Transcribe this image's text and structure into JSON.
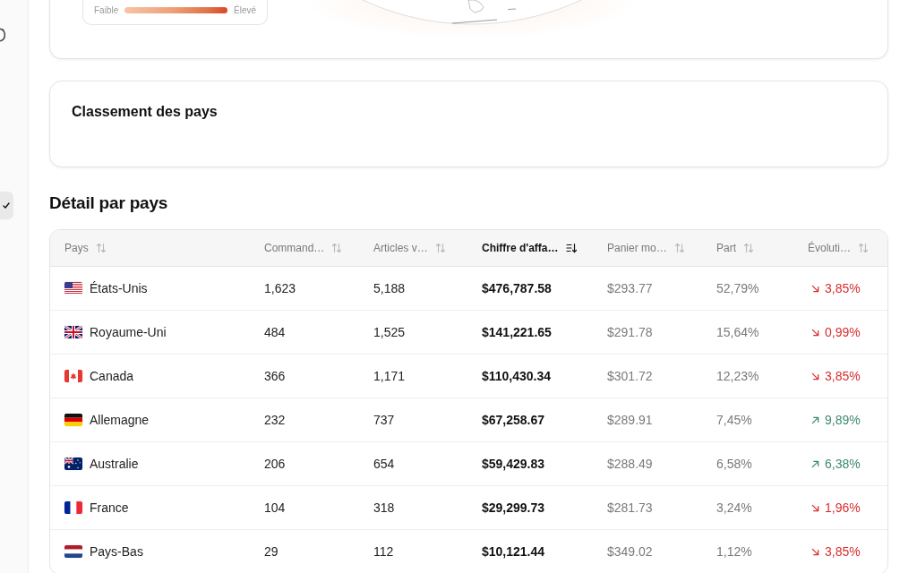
{
  "sidebar": {
    "items": [
      {
        "selected": false
      },
      {
        "selected": true
      }
    ]
  },
  "map_card": {
    "legend": {
      "low_label": "Faible",
      "high_label": "Élevé"
    }
  },
  "ranking_card": {
    "title": "Classement des pays"
  },
  "detail": {
    "title": "Détail par pays",
    "table": {
      "columns": [
        {
          "label": "Pays",
          "selected": false
        },
        {
          "label": "Command…",
          "selected": false
        },
        {
          "label": "Articles v…",
          "selected": false
        },
        {
          "label": "Chiffre d'affa…",
          "selected": true
        },
        {
          "label": "Panier mo…",
          "selected": false
        },
        {
          "label": "Part",
          "selected": false
        },
        {
          "label": "Évoluti…",
          "selected": false
        }
      ],
      "rows": [
        {
          "kind": "usa",
          "country": "États-Unis",
          "orders": "1,623",
          "items": "5,188",
          "revenue": "$476,787.58",
          "avg_basket": "$293.77",
          "share": "52,79%",
          "rising": false,
          "evolution": "3,85%"
        },
        {
          "kind": "uk",
          "country": "Royaume-Uni",
          "orders": "484",
          "items": "1,525",
          "revenue": "$141,221.65",
          "avg_basket": "$291.78",
          "share": "15,64%",
          "rising": false,
          "evolution": "0,99%"
        },
        {
          "kind": "canada",
          "country": "Canada",
          "orders": "366",
          "items": "1,171",
          "revenue": "$110,430.34",
          "avg_basket": "$301.72",
          "share": "12,23%",
          "rising": false,
          "evolution": "3,85%"
        },
        {
          "kind": "germany",
          "country": "Allemagne",
          "orders": "232",
          "items": "737",
          "revenue": "$67,258.67",
          "avg_basket": "$289.91",
          "share": "7,45%",
          "rising": true,
          "evolution": "9,89%"
        },
        {
          "kind": "australia",
          "country": "Australie",
          "orders": "206",
          "items": "654",
          "revenue": "$59,429.83",
          "avg_basket": "$288.49",
          "share": "6,58%",
          "rising": true,
          "evolution": "6,38%"
        },
        {
          "kind": "france",
          "country": "France",
          "orders": "104",
          "items": "318",
          "revenue": "$29,299.73",
          "avg_basket": "$281.73",
          "share": "3,24%",
          "rising": false,
          "evolution": "1,96%"
        },
        {
          "kind": "netherlands",
          "country": "Pays-Bas",
          "orders": "29",
          "items": "112",
          "revenue": "$10,121.44",
          "avg_basket": "$349.02",
          "share": "1,12%",
          "rising": false,
          "evolution": "3,85%"
        }
      ]
    }
  }
}
